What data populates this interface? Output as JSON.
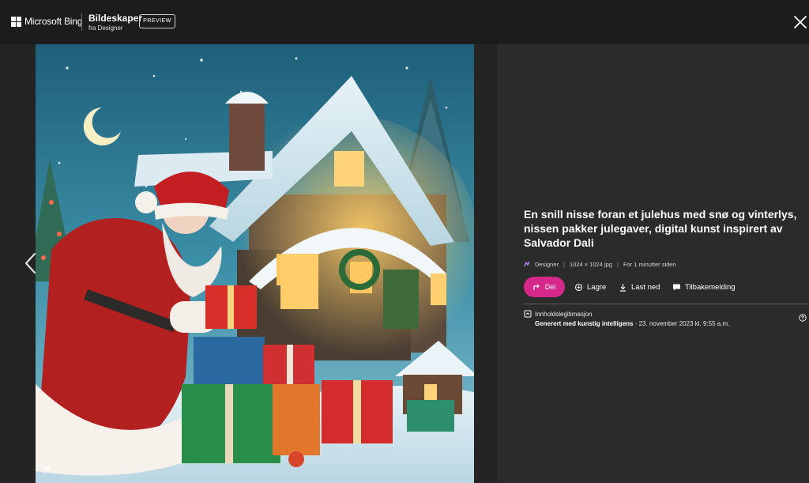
{
  "header": {
    "brand": "Microsoft Bing",
    "product_title": "Bildeskaper",
    "product_subtitle": "fra Designer",
    "badge": "PREVIEW"
  },
  "image": {
    "alt_description": "illustration"
  },
  "details": {
    "prompt": "En snill nisse foran et julehus med snø og vinterlys, nissen pakker julegaver, digital kunst inspirert av Salvador Dali",
    "source": "Designer",
    "dimensions": "1024 × 1024 jpg",
    "age": "For 1 minutter siden"
  },
  "actions": {
    "share": "Del",
    "save": "Lagre",
    "download": "Last ned",
    "feedback": "Tilbakemelding"
  },
  "credentials": {
    "title": "Innholdslegitimasjon",
    "generated_label": "Generert med kunstig intelligens",
    "generated_date": " · 23. november 2023 kl. 9:55 a.m."
  },
  "colors": {
    "accent": "#d6278b",
    "background": "#242424",
    "panel": "#2b2b2b"
  },
  "icons": [
    "microsoft-logo-icon",
    "close-icon",
    "chevron-left-icon",
    "share-icon",
    "save-collection-icon",
    "download-icon",
    "feedback-icon",
    "credentials-icon",
    "help-icon",
    "designer-icon"
  ]
}
